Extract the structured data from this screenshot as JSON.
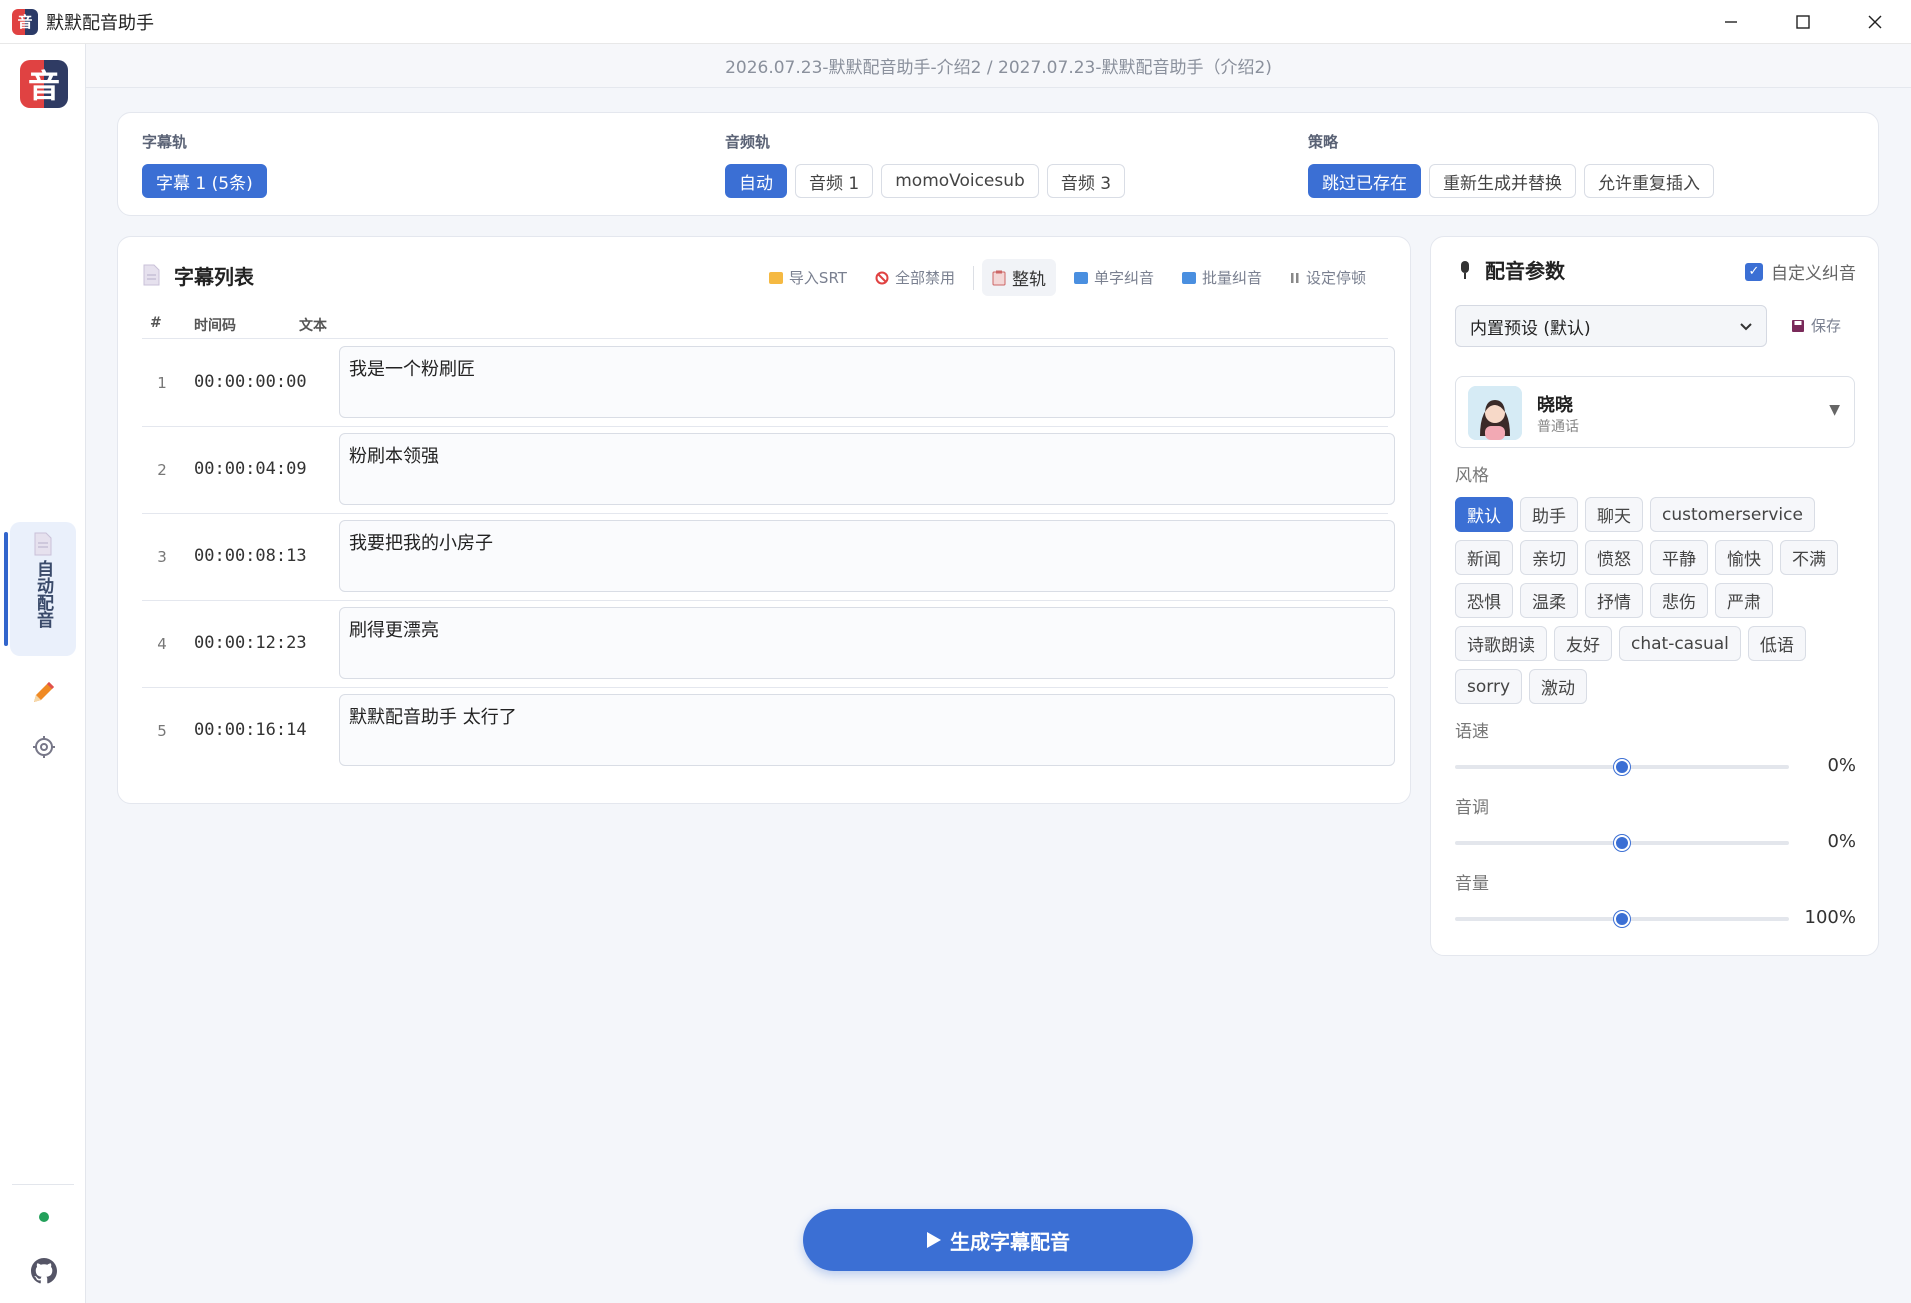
{
  "window": {
    "title": "默默配音助手",
    "minimize_icon": "minimize-icon",
    "maximize_icon": "maximize-icon",
    "close_icon": "close-icon"
  },
  "sidebar": {
    "logo_text": "音",
    "active_item": "自动配音",
    "items": [
      {
        "icon": "document-icon",
        "label": "自动配音"
      },
      {
        "icon": "pencil-icon"
      },
      {
        "icon": "gear-icon"
      }
    ],
    "status_color": "#22a05a"
  },
  "breadcrumb": "2026.07.23-默默配音助手-介绍2 / 2027.07.23-默默配音助手（介绍2)",
  "tracks": {
    "subtitle": {
      "label": "字幕轨",
      "options": [
        "字幕 1 (5条)"
      ],
      "selected": 0
    },
    "audio": {
      "label": "音频轨",
      "options": [
        "自动",
        "音频 1",
        "momoVoicesub",
        "音频 3"
      ],
      "selected": 0
    },
    "strategy": {
      "label": "策略",
      "options": [
        "跳过已存在",
        "重新生成并替换",
        "允许重复插入"
      ],
      "selected": 0
    }
  },
  "subtitle_list": {
    "title": "字幕列表",
    "tools": [
      "导入SRT",
      "全部禁用",
      "整轨",
      "单字纠音",
      "批量纠音",
      "设定停顿"
    ],
    "columns": [
      "#",
      "时间码",
      "文本"
    ],
    "rows": [
      {
        "index": "1",
        "timecode": "00:00:00:00",
        "text": "我是一个粉刷匠"
      },
      {
        "index": "2",
        "timecode": "00:00:04:09",
        "text": "粉刷本领强"
      },
      {
        "index": "3",
        "timecode": "00:00:08:13",
        "text": "我要把我的小房子"
      },
      {
        "index": "4",
        "timecode": "00:00:12:23",
        "text": "刷得更漂亮"
      },
      {
        "index": "5",
        "timecode": "00:00:16:14",
        "text": "默默配音助手 太行了"
      }
    ]
  },
  "params": {
    "title": "配音参数",
    "custom_pron_label": "自定义纠音",
    "custom_pron_checked": true,
    "preset": "内置预设 (默认)",
    "save_label": "保存",
    "voice": {
      "name": "晓晓",
      "lang": "普通话",
      "dropdown": "▼"
    },
    "style_label": "风格",
    "styles": [
      "默认",
      "助手",
      "聊天",
      "customerservice",
      "新闻",
      "亲切",
      "愤怒",
      "平静",
      "愉快",
      "不满",
      "恐惧",
      "温柔",
      "抒情",
      "悲伤",
      "严肃",
      "诗歌朗读",
      "友好",
      "chat-casual",
      "低语",
      "sorry",
      "激动"
    ],
    "style_selected": 0,
    "sliders": [
      {
        "label": "语速",
        "value": "0%",
        "level": 0.5
      },
      {
        "label": "音调",
        "value": "0%",
        "level": 0.5
      },
      {
        "label": "音量",
        "value": "100%",
        "level": 0.5
      }
    ]
  },
  "generate_label": "生成字幕配音",
  "accent_color": "#3b6fd4"
}
